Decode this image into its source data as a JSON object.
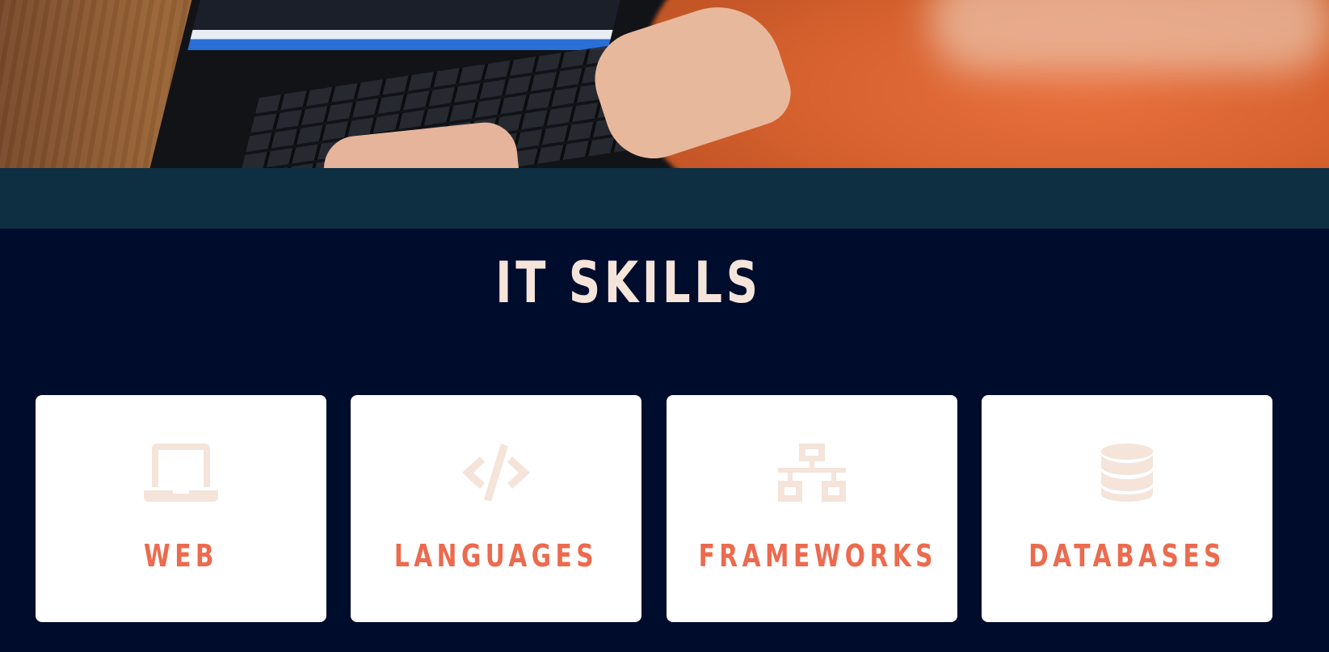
{
  "section": {
    "title": "IT SKILLS"
  },
  "skills": [
    {
      "label": "WEB",
      "icon": "laptop-icon"
    },
    {
      "label": "LANGUAGES",
      "icon": "code-icon"
    },
    {
      "label": "FRAMEWORKS",
      "icon": "network-icon"
    },
    {
      "label": "DATABASES",
      "icon": "database-icon"
    }
  ],
  "colors": {
    "background": "#000c2c",
    "band": "#0e2e42",
    "title": "#f5e4da",
    "accent": "#ec6a4e",
    "icon": "#f5e4da",
    "card": "#ffffff"
  }
}
